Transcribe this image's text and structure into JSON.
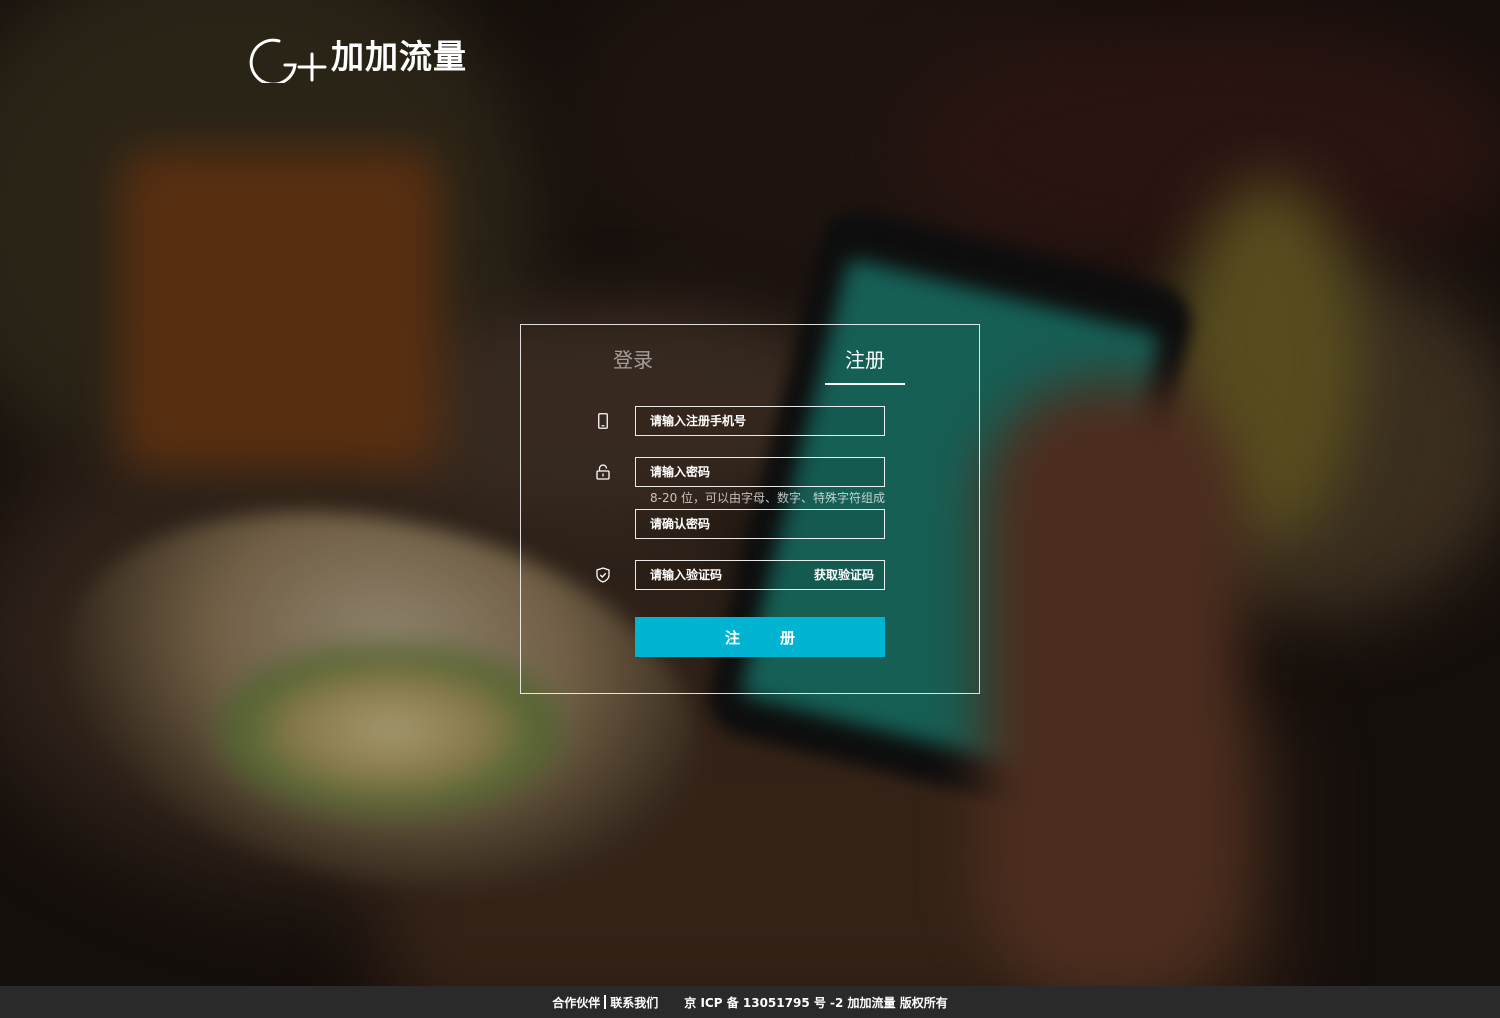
{
  "brand": {
    "name": "加加流量",
    "logo_icon": "g-plus-logo-icon"
  },
  "tabs": {
    "login": "登录",
    "register": "注册",
    "active": "register"
  },
  "form": {
    "phone_placeholder": "请输入注册手机号",
    "password_placeholder": "请输入密码",
    "password_hint": "8-20 位，可以由字母、数字、特殊字符组成",
    "confirm_placeholder": "请确认密码",
    "code_placeholder": "请输入验证码",
    "get_code_label": "获取验证码",
    "submit_label": "注册"
  },
  "icons": {
    "phone": "mobile-phone-icon",
    "lock": "lock-icon",
    "shield": "shield-check-icon"
  },
  "footer": {
    "partners": "合作伙伴",
    "contact": "联系我们",
    "icp": "京 ICP 备 13051795 号 -2 加加流量  版权所有"
  },
  "colors": {
    "accent": "#00b4d2",
    "footer_bg": "#2a2a2a"
  }
}
